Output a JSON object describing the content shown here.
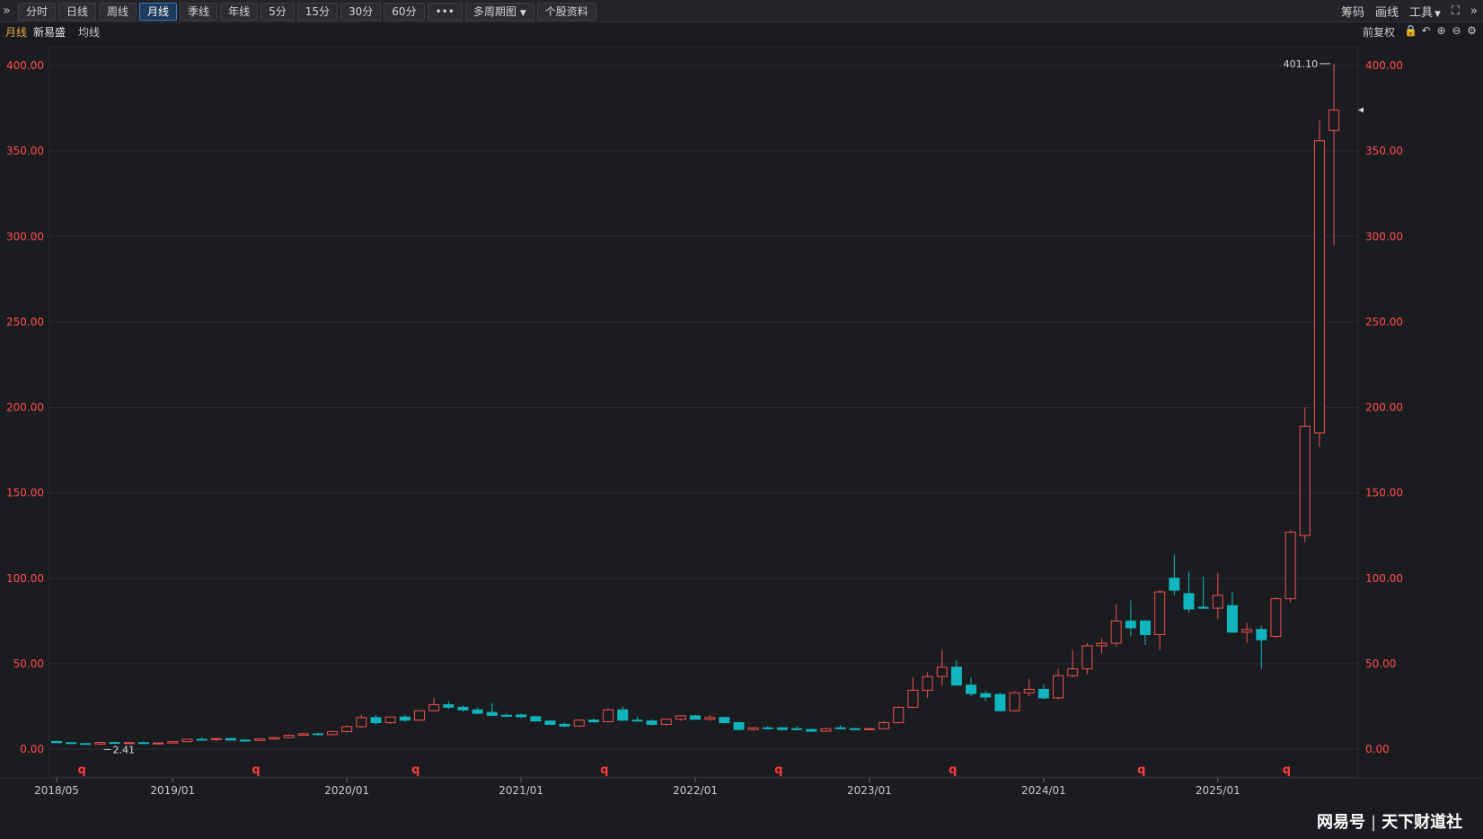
{
  "toolbar": {
    "tabs": [
      "分时",
      "日线",
      "周线",
      "月线",
      "季线",
      "年线",
      "5分",
      "15分",
      "30分",
      "60分",
      "•••",
      "多周期图",
      "个股资料"
    ],
    "active_tab": "月线",
    "right": [
      "筹码",
      "画线",
      "工具"
    ]
  },
  "subbar": {
    "period": "月线",
    "stock": "新易盛",
    "ma": "均线",
    "adjust": "前复权"
  },
  "watermark": {
    "source": "网易号",
    "author": "天下财道社"
  },
  "colors": {
    "up": "#f04f4f",
    "down": "#11b5bd",
    "axis_text": "#ff4d4d",
    "grid": "#2c2d33"
  },
  "chart_data": {
    "type": "candlestick",
    "title": "",
    "xlabel": "",
    "ylabel": "",
    "ylim": [
      0,
      400
    ],
    "yticks": [
      0,
      50,
      100,
      150,
      200,
      250,
      300,
      350,
      400
    ],
    "ytick_labels": [
      "0.00",
      "50.00",
      "100.00",
      "150.00",
      "200.00",
      "250.00",
      "300.00",
      "350.00",
      "400.00"
    ],
    "xtick_labels": [
      {
        "month_index": 0,
        "label": "2018/05"
      },
      {
        "month_index": 8,
        "label": "2019/01"
      },
      {
        "month_index": 20,
        "label": "2020/01"
      },
      {
        "month_index": 32,
        "label": "2021/01"
      },
      {
        "month_index": 44,
        "label": "2022/01"
      },
      {
        "month_index": 56,
        "label": "2023/01"
      },
      {
        "month_index": 68,
        "label": "2024/01"
      },
      {
        "month_index": 80,
        "label": "2025/01"
      }
    ],
    "markers": [
      {
        "month_index": 1,
        "label": "q"
      },
      {
        "month_index": 13,
        "label": "q"
      },
      {
        "month_index": 24,
        "label": "q"
      },
      {
        "month_index": 37,
        "label": "q"
      },
      {
        "month_index": 49,
        "label": "q"
      },
      {
        "month_index": 61,
        "label": "q"
      },
      {
        "month_index": 74,
        "label": "q"
      },
      {
        "month_index": 84,
        "label": "q"
      }
    ],
    "annotations": [
      {
        "label": "401.10",
        "value": 401.1
      },
      {
        "label": "2.41",
        "value": 2.41
      }
    ],
    "candles": [
      {
        "month": "2018/05",
        "o": 4.5,
        "h": 5.0,
        "l": 3.6,
        "c": 3.8
      },
      {
        "month": "2018/06",
        "o": 3.8,
        "h": 4.0,
        "l": 3.0,
        "c": 3.3
      },
      {
        "month": "2018/07",
        "o": 3.3,
        "h": 3.6,
        "l": 2.8,
        "c": 3.0
      },
      {
        "month": "2018/08",
        "o": 3.0,
        "h": 4.2,
        "l": 2.41,
        "c": 3.9
      },
      {
        "month": "2018/09",
        "o": 3.9,
        "h": 4.3,
        "l": 3.2,
        "c": 3.4
      },
      {
        "month": "2018/10",
        "o": 3.4,
        "h": 4.0,
        "l": 3.0,
        "c": 3.8
      },
      {
        "month": "2018/11",
        "o": 3.8,
        "h": 4.3,
        "l": 3.5,
        "c": 3.5
      },
      {
        "month": "2018/12",
        "o": 3.5,
        "h": 3.9,
        "l": 3.2,
        "c": 3.6
      },
      {
        "month": "2019/01",
        "o": 3.6,
        "h": 4.6,
        "l": 3.4,
        "c": 4.4
      },
      {
        "month": "2019/02",
        "o": 4.4,
        "h": 6.0,
        "l": 4.2,
        "c": 5.8
      },
      {
        "month": "2019/03",
        "o": 5.8,
        "h": 7.0,
        "l": 5.2,
        "c": 5.6
      },
      {
        "month": "2019/04",
        "o": 5.6,
        "h": 6.8,
        "l": 5.0,
        "c": 6.2
      },
      {
        "month": "2019/05",
        "o": 6.2,
        "h": 6.6,
        "l": 5.0,
        "c": 5.3
      },
      {
        "month": "2019/06",
        "o": 5.3,
        "h": 5.9,
        "l": 4.8,
        "c": 5.1
      },
      {
        "month": "2019/07",
        "o": 5.1,
        "h": 6.4,
        "l": 4.9,
        "c": 6.0
      },
      {
        "month": "2019/08",
        "o": 6.0,
        "h": 7.2,
        "l": 5.6,
        "c": 6.8
      },
      {
        "month": "2019/09",
        "o": 6.8,
        "h": 8.6,
        "l": 6.4,
        "c": 8.1
      },
      {
        "month": "2019/10",
        "o": 8.1,
        "h": 9.6,
        "l": 7.6,
        "c": 9.0
      },
      {
        "month": "2019/11",
        "o": 9.0,
        "h": 9.6,
        "l": 8.2,
        "c": 8.5
      },
      {
        "month": "2019/12",
        "o": 8.5,
        "h": 10.8,
        "l": 8.0,
        "c": 10.3
      },
      {
        "month": "2020/01",
        "o": 10.3,
        "h": 14.0,
        "l": 10.0,
        "c": 13.2
      },
      {
        "month": "2020/02",
        "o": 13.2,
        "h": 20.0,
        "l": 12.5,
        "c": 18.5
      },
      {
        "month": "2020/03",
        "o": 18.5,
        "h": 20.0,
        "l": 14.5,
        "c": 15.5
      },
      {
        "month": "2020/04",
        "o": 15.5,
        "h": 19.0,
        "l": 14.8,
        "c": 18.8
      },
      {
        "month": "2020/05",
        "o": 18.8,
        "h": 20.0,
        "l": 16.0,
        "c": 17.0
      },
      {
        "month": "2020/06",
        "o": 17.0,
        "h": 23.0,
        "l": 16.5,
        "c": 22.5
      },
      {
        "month": "2020/07",
        "o": 22.5,
        "h": 30.0,
        "l": 22.0,
        "c": 26.0
      },
      {
        "month": "2020/08",
        "o": 26.0,
        "h": 28.0,
        "l": 23.5,
        "c": 24.5
      },
      {
        "month": "2020/09",
        "o": 24.5,
        "h": 25.5,
        "l": 22.0,
        "c": 23.0
      },
      {
        "month": "2020/10",
        "o": 23.0,
        "h": 24.5,
        "l": 20.5,
        "c": 21.0
      },
      {
        "month": "2020/11",
        "o": 21.5,
        "h": 27.0,
        "l": 19.5,
        "c": 19.8
      },
      {
        "month": "2020/12",
        "o": 19.8,
        "h": 21.0,
        "l": 18.5,
        "c": 19.5
      },
      {
        "month": "2021/01",
        "o": 20.0,
        "h": 20.8,
        "l": 18.0,
        "c": 19.0
      },
      {
        "month": "2021/02",
        "o": 19.0,
        "h": 19.5,
        "l": 16.0,
        "c": 16.5
      },
      {
        "month": "2021/03",
        "o": 16.5,
        "h": 17.0,
        "l": 14.0,
        "c": 14.5
      },
      {
        "month": "2021/04",
        "o": 14.5,
        "h": 15.5,
        "l": 13.0,
        "c": 13.5
      },
      {
        "month": "2021/05",
        "o": 13.5,
        "h": 17.5,
        "l": 13.0,
        "c": 17.0
      },
      {
        "month": "2021/06",
        "o": 17.0,
        "h": 18.0,
        "l": 15.5,
        "c": 16.0
      },
      {
        "month": "2021/07",
        "o": 16.0,
        "h": 24.0,
        "l": 15.5,
        "c": 23.0
      },
      {
        "month": "2021/08",
        "o": 23.0,
        "h": 25.0,
        "l": 16.5,
        "c": 17.0
      },
      {
        "month": "2021/09",
        "o": 17.0,
        "h": 19.0,
        "l": 16.0,
        "c": 16.5
      },
      {
        "month": "2021/10",
        "o": 16.5,
        "h": 17.5,
        "l": 14.0,
        "c": 14.5
      },
      {
        "month": "2021/11",
        "o": 14.5,
        "h": 18.0,
        "l": 14.0,
        "c": 17.5
      },
      {
        "month": "2021/12",
        "o": 17.5,
        "h": 20.0,
        "l": 16.5,
        "c": 19.5
      },
      {
        "month": "2022/01",
        "o": 19.5,
        "h": 20.0,
        "l": 17.0,
        "c": 17.5
      },
      {
        "month": "2022/02",
        "o": 17.5,
        "h": 20.0,
        "l": 16.5,
        "c": 18.5
      },
      {
        "month": "2022/03",
        "o": 18.5,
        "h": 19.0,
        "l": 15.0,
        "c": 15.5
      },
      {
        "month": "2022/04",
        "o": 15.5,
        "h": 16.0,
        "l": 11.0,
        "c": 11.5
      },
      {
        "month": "2022/05",
        "o": 11.5,
        "h": 13.0,
        "l": 11.0,
        "c": 12.5
      },
      {
        "month": "2022/06",
        "o": 12.5,
        "h": 13.5,
        "l": 11.5,
        "c": 12.0
      },
      {
        "month": "2022/07",
        "o": 12.5,
        "h": 13.0,
        "l": 11.0,
        "c": 11.5
      },
      {
        "month": "2022/08",
        "o": 12.0,
        "h": 13.5,
        "l": 11.0,
        "c": 11.5
      },
      {
        "month": "2022/09",
        "o": 11.5,
        "h": 12.0,
        "l": 10.0,
        "c": 10.5
      },
      {
        "month": "2022/10",
        "o": 10.5,
        "h": 12.5,
        "l": 10.0,
        "c": 12.0
      },
      {
        "month": "2022/11",
        "o": 12.5,
        "h": 14.0,
        "l": 11.5,
        "c": 12.0
      },
      {
        "month": "2022/12",
        "o": 12.0,
        "h": 12.5,
        "l": 11.0,
        "c": 11.5
      },
      {
        "month": "2023/01",
        "o": 11.5,
        "h": 12.5,
        "l": 11.0,
        "c": 12.0
      },
      {
        "month": "2023/02",
        "o": 12.0,
        "h": 16.5,
        "l": 11.5,
        "c": 15.5
      },
      {
        "month": "2023/03",
        "o": 15.5,
        "h": 25.0,
        "l": 15.0,
        "c": 24.5
      },
      {
        "month": "2023/04",
        "o": 24.5,
        "h": 42.0,
        "l": 24.0,
        "c": 34.5
      },
      {
        "month": "2023/05",
        "o": 34.5,
        "h": 45.0,
        "l": 30.0,
        "c": 42.5
      },
      {
        "month": "2023/06",
        "o": 42.5,
        "h": 58.0,
        "l": 37.0,
        "c": 48.0
      },
      {
        "month": "2023/07",
        "o": 48.0,
        "h": 52.0,
        "l": 37.0,
        "c": 37.5
      },
      {
        "month": "2023/08",
        "o": 37.5,
        "h": 42.0,
        "l": 31.0,
        "c": 32.5
      },
      {
        "month": "2023/09",
        "o": 32.5,
        "h": 34.0,
        "l": 28.0,
        "c": 30.5
      },
      {
        "month": "2023/10",
        "o": 32.0,
        "h": 33.0,
        "l": 22.0,
        "c": 22.5
      },
      {
        "month": "2023/11",
        "o": 22.5,
        "h": 34.0,
        "l": 22.0,
        "c": 33.0
      },
      {
        "month": "2023/12",
        "o": 33.0,
        "h": 41.0,
        "l": 31.0,
        "c": 35.0
      },
      {
        "month": "2024/01",
        "o": 35.0,
        "h": 38.0,
        "l": 29.0,
        "c": 30.0
      },
      {
        "month": "2024/02",
        "o": 30.0,
        "h": 47.0,
        "l": 29.0,
        "c": 43.0
      },
      {
        "month": "2024/03",
        "o": 43.0,
        "h": 58.0,
        "l": 42.0,
        "c": 47.0
      },
      {
        "month": "2024/04",
        "o": 47.0,
        "h": 62.0,
        "l": 44.0,
        "c": 60.5
      },
      {
        "month": "2024/05",
        "o": 60.5,
        "h": 65.0,
        "l": 56.0,
        "c": 62.0
      },
      {
        "month": "2024/06",
        "o": 62.0,
        "h": 85.0,
        "l": 60.0,
        "c": 75.0
      },
      {
        "month": "2024/07",
        "o": 75.0,
        "h": 87.0,
        "l": 66.0,
        "c": 71.0
      },
      {
        "month": "2024/08",
        "o": 75.0,
        "h": 75.5,
        "l": 61.0,
        "c": 67.0
      },
      {
        "month": "2024/09",
        "o": 67.0,
        "h": 93.0,
        "l": 58.0,
        "c": 92.0
      },
      {
        "month": "2024/10",
        "o": 100.0,
        "h": 114.0,
        "l": 90.0,
        "c": 93.0
      },
      {
        "month": "2024/11",
        "o": 91.0,
        "h": 104.0,
        "l": 80.0,
        "c": 82.0
      },
      {
        "month": "2024/12",
        "o": 83.0,
        "h": 101.0,
        "l": 82.0,
        "c": 82.5
      },
      {
        "month": "2025/01",
        "o": 82.5,
        "h": 103.0,
        "l": 76.0,
        "c": 90.0
      },
      {
        "month": "2025/02",
        "o": 84.0,
        "h": 92.0,
        "l": 68.0,
        "c": 68.5
      },
      {
        "month": "2025/03",
        "o": 68.5,
        "h": 74.0,
        "l": 62.0,
        "c": 70.0
      },
      {
        "month": "2025/04",
        "o": 70.0,
        "h": 72.0,
        "l": 47.0,
        "c": 64.0
      },
      {
        "month": "2025/05",
        "o": 66.0,
        "h": 89.0,
        "l": 65.0,
        "c": 88.0
      },
      {
        "month": "2025/06",
        "o": 88.0,
        "h": 128.0,
        "l": 86.0,
        "c": 127.0
      },
      {
        "month": "2025/07",
        "o": 125.0,
        "h": 200.0,
        "l": 121.0,
        "c": 189.0
      },
      {
        "month": "2025/08",
        "o": 185.0,
        "h": 368.0,
        "l": 177.0,
        "c": 356.0
      },
      {
        "month": "2025/09",
        "o": 362.0,
        "h": 401.1,
        "l": 295.0,
        "c": 374.0
      }
    ]
  }
}
